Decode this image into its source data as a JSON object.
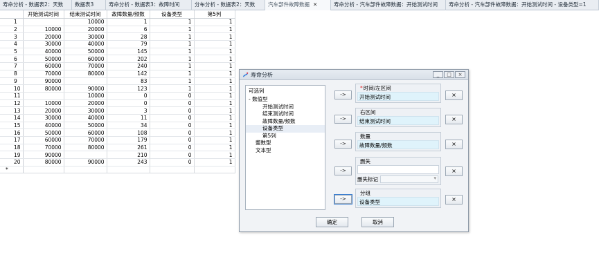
{
  "tabs": [
    {
      "label": "寿命分析 - 数据表2：天数"
    },
    {
      "label": "数据表3"
    },
    {
      "label": "寿命分析 - 数据表3：故障时间"
    },
    {
      "label": "分布分析 - 数据表2：天数"
    },
    {
      "label": "汽车部件故障数据",
      "close": "✕"
    },
    {
      "label": "寿命分析 - 汽车部件故障数据：开始测试时间"
    },
    {
      "label": "寿命分析 - 汽车部件故障数据：开始测试时间 - 设备类型=1"
    }
  ],
  "grid": {
    "headers": [
      "",
      "开始测试时间",
      "结束测试时间",
      "故障数量/频数",
      "设备类型",
      "第5列"
    ],
    "rows": [
      [
        "1",
        "",
        "10000",
        "1",
        "1",
        "1"
      ],
      [
        "2",
        "10000",
        "20000",
        "6",
        "1",
        "1"
      ],
      [
        "3",
        "20000",
        "30000",
        "28",
        "1",
        "1"
      ],
      [
        "4",
        "30000",
        "40000",
        "79",
        "1",
        "1"
      ],
      [
        "5",
        "40000",
        "50000",
        "145",
        "1",
        "1"
      ],
      [
        "6",
        "50000",
        "60000",
        "202",
        "1",
        "1"
      ],
      [
        "7",
        "60000",
        "70000",
        "240",
        "1",
        "1"
      ],
      [
        "8",
        "70000",
        "80000",
        "142",
        "1",
        "1"
      ],
      [
        "9",
        "90000",
        "",
        "83",
        "1",
        "1"
      ],
      [
        "10",
        "80000",
        "90000",
        "123",
        "1",
        "1"
      ],
      [
        "11",
        "",
        "10000",
        "0",
        "0",
        "1"
      ],
      [
        "12",
        "10000",
        "20000",
        "0",
        "0",
        "1"
      ],
      [
        "13",
        "20000",
        "30000",
        "3",
        "0",
        "1"
      ],
      [
        "14",
        "30000",
        "40000",
        "11",
        "0",
        "1"
      ],
      [
        "15",
        "40000",
        "50000",
        "34",
        "0",
        "1"
      ],
      [
        "16",
        "50000",
        "60000",
        "108",
        "0",
        "1"
      ],
      [
        "17",
        "60000",
        "70000",
        "179",
        "0",
        "1"
      ],
      [
        "18",
        "70000",
        "80000",
        "261",
        "0",
        "1"
      ],
      [
        "19",
        "90000",
        "",
        "210",
        "0",
        "1"
      ],
      [
        "20",
        "80000",
        "90000",
        "243",
        "0",
        "1"
      ]
    ],
    "new_row_marker": "*"
  },
  "dialog": {
    "title": "寿命分析",
    "window_buttons": [
      "_",
      "□",
      "×"
    ],
    "var_list": {
      "header": "可选列",
      "groups": [
        {
          "label": "数值型",
          "expanded": "-",
          "children": [
            "开始测试时间",
            "结束测试时间",
            "故障数量/频数",
            "设备类型",
            "第5列"
          ]
        },
        {
          "label": "整数型"
        },
        {
          "label": "文本型"
        }
      ]
    },
    "fields": {
      "time_left": {
        "required_mark": "*",
        "label": "时间/左区间",
        "value": "开始测试时间"
      },
      "right": {
        "label": "右区间",
        "value": "结束测试时间"
      },
      "count": {
        "label": "数量",
        "value": "故障数量/频数"
      },
      "censor": {
        "label": "删失",
        "value": "",
        "flag_label": "删失标记"
      },
      "group": {
        "label": "分组",
        "value": "设备类型"
      }
    },
    "arrow_label": "->",
    "remove_label": "×",
    "ok_label": "确定",
    "cancel_label": "取消"
  }
}
